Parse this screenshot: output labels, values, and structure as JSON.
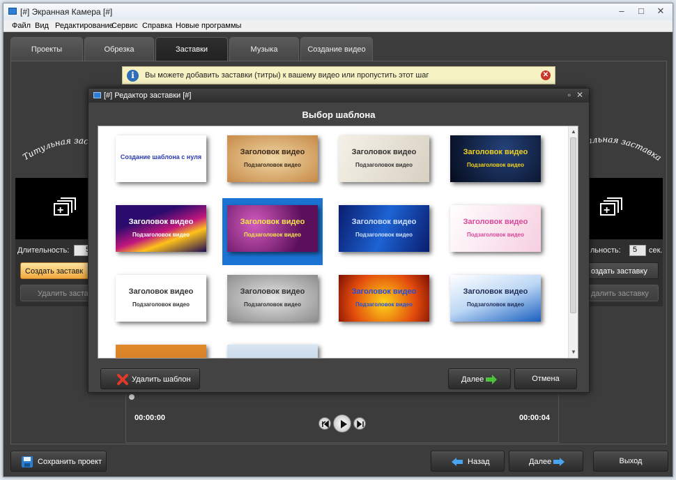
{
  "app": {
    "title": "[#] Экранная Камера [#]"
  },
  "menu": [
    "Файл",
    "Вид",
    "Редактирование",
    "Сервис",
    "Справка",
    "Новые программы"
  ],
  "tabs": [
    {
      "label": "Проекты"
    },
    {
      "label": "Обрезка"
    },
    {
      "label": "Заставки",
      "active": true
    },
    {
      "label": "Музыка"
    },
    {
      "label": "Создание видео"
    }
  ],
  "info": {
    "text": "Вы можете добавить заставки (титры) к вашему видео или пропустить этот шаг"
  },
  "left_panel": {
    "arc_text": "Титульная заста",
    "duration_label": "Длительность:",
    "duration_value": "5",
    "create_label": "Создать заставк",
    "delete_label": "Удалить застав"
  },
  "right_panel": {
    "arc_text": "альная заставка",
    "duration_label": "льность:",
    "duration_value": "5",
    "unit": "сек.",
    "create_label": "оздать заставку",
    "delete_label": "далить заставку"
  },
  "player": {
    "time_start": "00:00:00",
    "time_end": "00:00:04"
  },
  "dialog": {
    "title": "[#] Редактор заставки [#]",
    "heading": "Выбор шаблона",
    "delete_label": "Удалить шаблон",
    "next_label": "Далее",
    "cancel_label": "Отмена"
  },
  "templates": [
    {
      "title": "Создание шаблона с нуля",
      "subtitle": "",
      "style": "blank"
    },
    {
      "title": "Заголовок видео",
      "subtitle": "Подзаголовок видео",
      "style": "parchment"
    },
    {
      "title": "Заголовок видео",
      "subtitle": "Подзаголовок видео",
      "style": "ink"
    },
    {
      "title": "Заголовок видео",
      "subtitle": "Подзаголовок видео",
      "style": "night"
    },
    {
      "title": "Заголовок видео",
      "subtitle": "Подзаголовок видео",
      "style": "rainbow"
    },
    {
      "title": "Заголовок видео",
      "subtitle": "Подзаголовок видео",
      "style": "purple-floral",
      "selected": true
    },
    {
      "title": "Заголовок видео",
      "subtitle": "Подзаголовок видео",
      "style": "blue-rays"
    },
    {
      "title": "Заголовок видео",
      "subtitle": "Подзаголовок видео",
      "style": "pink-floral"
    },
    {
      "title": "Заголовок видео",
      "subtitle": "Подзаголовок видео",
      "style": "speakers"
    },
    {
      "title": "Заголовок видео",
      "subtitle": "Подзаголовок видео",
      "style": "silver"
    },
    {
      "title": "Заголовок видео",
      "subtitle": "Подзаголовок видео",
      "style": "fire"
    },
    {
      "title": "Заголовок видео",
      "subtitle": "Подзаголовок видео",
      "style": "film"
    },
    {
      "title": "",
      "subtitle": "",
      "style": "orange-partial"
    },
    {
      "title": "",
      "subtitle": "",
      "style": "sky-partial"
    }
  ],
  "bottom": {
    "save_label": "Сохранить проект",
    "back_label": "Назад",
    "next_label": "Далее",
    "exit_label": "Выход"
  }
}
